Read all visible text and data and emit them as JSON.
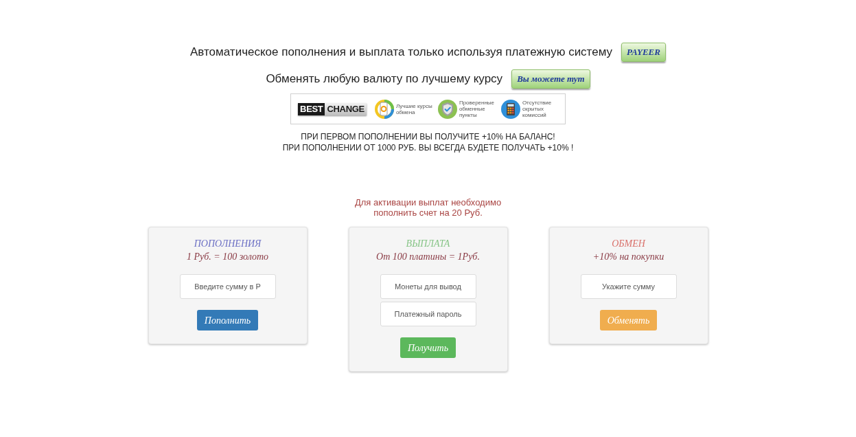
{
  "header": {
    "lines": [
      {
        "text": "Автоматическое пополнения и выплата только используя платежную систему",
        "button": "PAYEER"
      },
      {
        "text": "Обменять любую валюту по лучшему курсу",
        "button": "Вы можете тут"
      }
    ]
  },
  "banner": {
    "logo": [
      "BEST",
      "CHANGE"
    ],
    "features": [
      {
        "kind": "phone",
        "text": "Лучшие курсы обмена"
      },
      {
        "kind": "shield",
        "text": "Проверенные обменные пункты"
      },
      {
        "kind": "calculator",
        "text": "Отсутствие скрытых комиссий"
      }
    ]
  },
  "notices": [
    "ПРИ ПЕРВОМ ПОПОЛНЕНИИ ВЫ ПОЛУЧИТЕ +10% НА БАЛАНС!",
    "ПРИ ПОПОЛНЕНИИ ОТ 1000 РУБ. ВЫ ВСЕГДА БУДЕТЕ ПОЛУЧАТЬ +10% !"
  ],
  "warning": [
    "Для активации выплат необходимо",
    "пополнить счет на 20 Руб."
  ],
  "cards": [
    {
      "title": {
        "text": "ПОПОЛНЕНИЯ",
        "color": "#6b6fc4"
      },
      "subtitle": "1 Руб. = 100 золото",
      "fields": [
        {
          "placeholder": "Введите сумму в Р"
        }
      ],
      "button": {
        "label": "Пополнить",
        "color": "#337ab7"
      }
    },
    {
      "title": {
        "text": "ВЫПЛАТА",
        "color": "#86c486"
      },
      "subtitle": "От 100 платины = 1Руб.",
      "fields": [
        {
          "placeholder": "Монеты для вывод"
        },
        {
          "placeholder": "Платежный пароль"
        }
      ],
      "button": {
        "label": "Получить",
        "color": "#5cb85c"
      }
    },
    {
      "title": {
        "text": "ОБМЕН",
        "color": "#d9706a"
      },
      "subtitle": "+10% на покупки",
      "fields": [
        {
          "placeholder": "Укажите сумму"
        }
      ],
      "button": {
        "label": "Обменять",
        "color": "#f0ad4e"
      }
    }
  ]
}
